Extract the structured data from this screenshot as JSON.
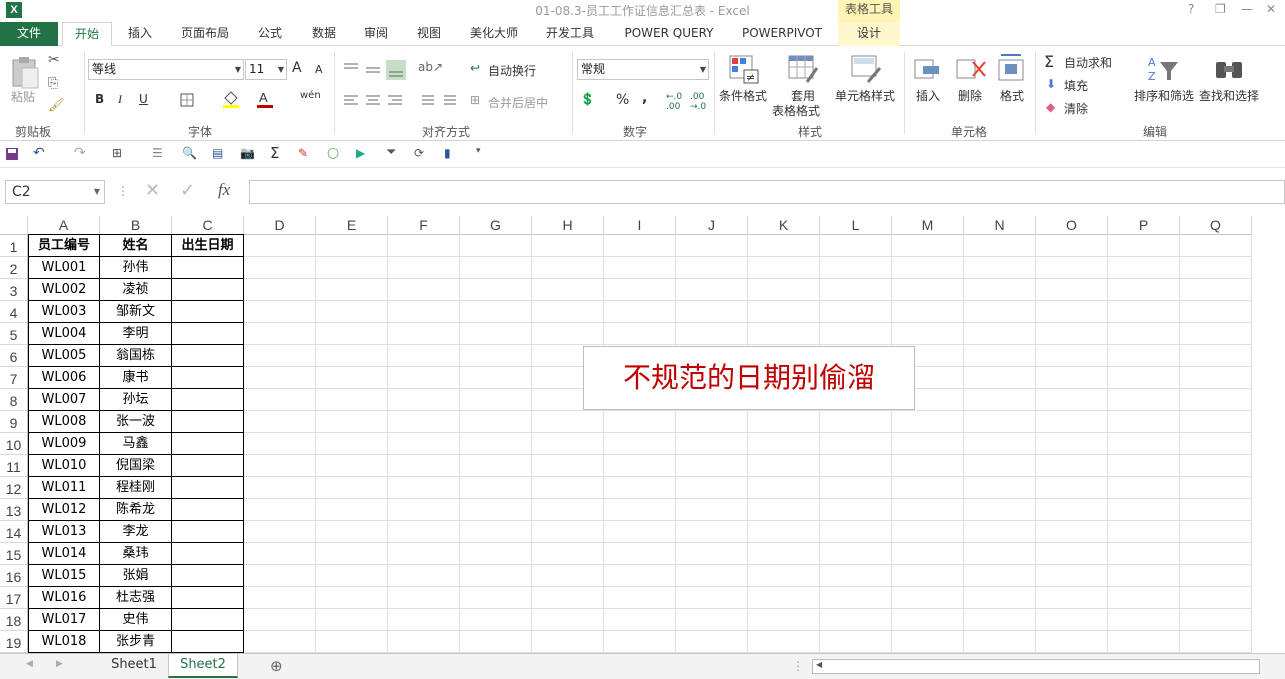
{
  "window": {
    "title": "01-08.3-员工工作证信息汇总表 - Excel",
    "context_tool": "表格工具",
    "help": "?",
    "min": "—",
    "restore": "❐",
    "close": "✕"
  },
  "tabs": [
    "文件",
    "开始",
    "插入",
    "页面布局",
    "公式",
    "数据",
    "审阅",
    "视图",
    "美化大师",
    "开发工具",
    "POWER QUERY",
    "POWERPIVOT",
    "设计"
  ],
  "ribbon": {
    "clipboard": {
      "paste": "粘贴",
      "label": "剪贴板"
    },
    "font": {
      "name": "等线",
      "size": "11",
      "grow": "A",
      "shrink": "A",
      "bold": "B",
      "italic": "I",
      "underline": "U",
      "wen": "wén",
      "label": "字体"
    },
    "align": {
      "wrap": "自动换行",
      "merge": "合并后居中",
      "label": "对齐方式"
    },
    "number": {
      "format": "常规",
      "percent": "%",
      "comma": ",",
      "inc": ".0\n.00",
      "dec": ".00\n.0",
      "label": "数字"
    },
    "styles": {
      "cond": "条件格式",
      "table1": "套用",
      "table2": "表格格式",
      "cell": "单元格样式",
      "label": "样式"
    },
    "cells": {
      "insert": "插入",
      "delete": "删除",
      "format": "格式",
      "label": "单元格"
    },
    "editing": {
      "autosum": "自动求和",
      "fill": "填充",
      "clear": "清除",
      "sort": "排序和筛选",
      "find": "查找和选择",
      "label": "编辑"
    }
  },
  "formula_bar": {
    "namebox": "C2",
    "fx": "fx",
    "cancel": "✕",
    "enter": "✓",
    "content": ""
  },
  "columns": [
    "A",
    "B",
    "C",
    "D",
    "E",
    "F",
    "G",
    "H",
    "I",
    "J",
    "K",
    "L",
    "M",
    "N",
    "O",
    "P",
    "Q"
  ],
  "rows": [
    "1",
    "2",
    "3",
    "4",
    "5",
    "6",
    "7",
    "8",
    "9",
    "10",
    "11",
    "12",
    "13",
    "14",
    "15",
    "16",
    "17",
    "18",
    "19"
  ],
  "table": {
    "headers": [
      "员工编号",
      "姓名",
      "出生日期"
    ],
    "data": [
      [
        "WL001",
        "孙伟",
        ""
      ],
      [
        "WL002",
        "凌祯",
        ""
      ],
      [
        "WL003",
        "邹新文",
        ""
      ],
      [
        "WL004",
        "李明",
        ""
      ],
      [
        "WL005",
        "翁国栋",
        ""
      ],
      [
        "WL006",
        "康书",
        ""
      ],
      [
        "WL007",
        "孙坛",
        ""
      ],
      [
        "WL008",
        "张一波",
        ""
      ],
      [
        "WL009",
        "马鑫",
        ""
      ],
      [
        "WL010",
        "倪国梁",
        ""
      ],
      [
        "WL011",
        "程桂刚",
        ""
      ],
      [
        "WL012",
        "陈希龙",
        ""
      ],
      [
        "WL013",
        "李龙",
        ""
      ],
      [
        "WL014",
        "桑玮",
        ""
      ],
      [
        "WL015",
        "张娟",
        ""
      ],
      [
        "WL016",
        "杜志强",
        ""
      ],
      [
        "WL017",
        "史伟",
        ""
      ],
      [
        "WL018",
        "张步青",
        ""
      ]
    ]
  },
  "callout": "不规范的日期别偷溜",
  "sheets": [
    "Sheet1",
    "Sheet2"
  ],
  "colors": {
    "excel_green": "#217346",
    "callout_red": "#c00000"
  }
}
